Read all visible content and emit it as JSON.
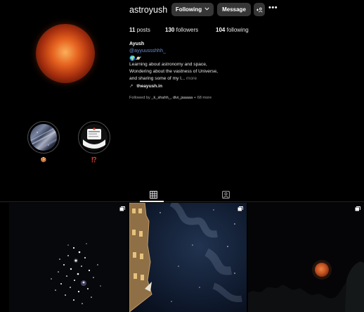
{
  "profile": {
    "username": "astroyush",
    "following_button": "Following",
    "message_button": "Message",
    "add_user_glyph": "+♗",
    "more_glyph": "•••",
    "icons": [
      "chevron-down-icon",
      "add-user-icon",
      "more-icon"
    ]
  },
  "stats": {
    "posts": {
      "count": "11",
      "label": "posts"
    },
    "followers": {
      "count": "130",
      "label": "followers"
    },
    "following": {
      "count": "104",
      "label": "following"
    }
  },
  "bio": {
    "name": "Ayush",
    "handle": "@ayyuussshhh_",
    "emoji": "🌍🪐",
    "line1": "Learning about astronomy and space,",
    "line2": "Wondering about the vastness of Universe,",
    "line3": "and sharing some of my l...",
    "more": "more",
    "link_icon": "↗",
    "link": "theayush.in",
    "followed_by_prefix": "Followed by",
    "followed_by_names": "_k_shahh_, divi_jaaaaa",
    "followed_by_suffix": "+ 68 more"
  },
  "highlights": [
    {
      "label": "🍪",
      "cover": "star-trails"
    },
    {
      "label": "⁉️",
      "cover": "notification-card"
    }
  ],
  "tabs": [
    {
      "name": "posts",
      "icon": "grid-icon",
      "active": true
    },
    {
      "name": "tagged",
      "icon": "tagged-icon",
      "active": false
    }
  ],
  "posts": [
    {
      "subject": "star-cluster",
      "multi": true
    },
    {
      "subject": "night-sky-building",
      "multi": true
    },
    {
      "subject": "red-moon",
      "multi": true
    }
  ],
  "colors": {
    "background": "#000000",
    "button": "#363636",
    "link": "#6c8bd1",
    "muted": "#a8a8a8"
  }
}
